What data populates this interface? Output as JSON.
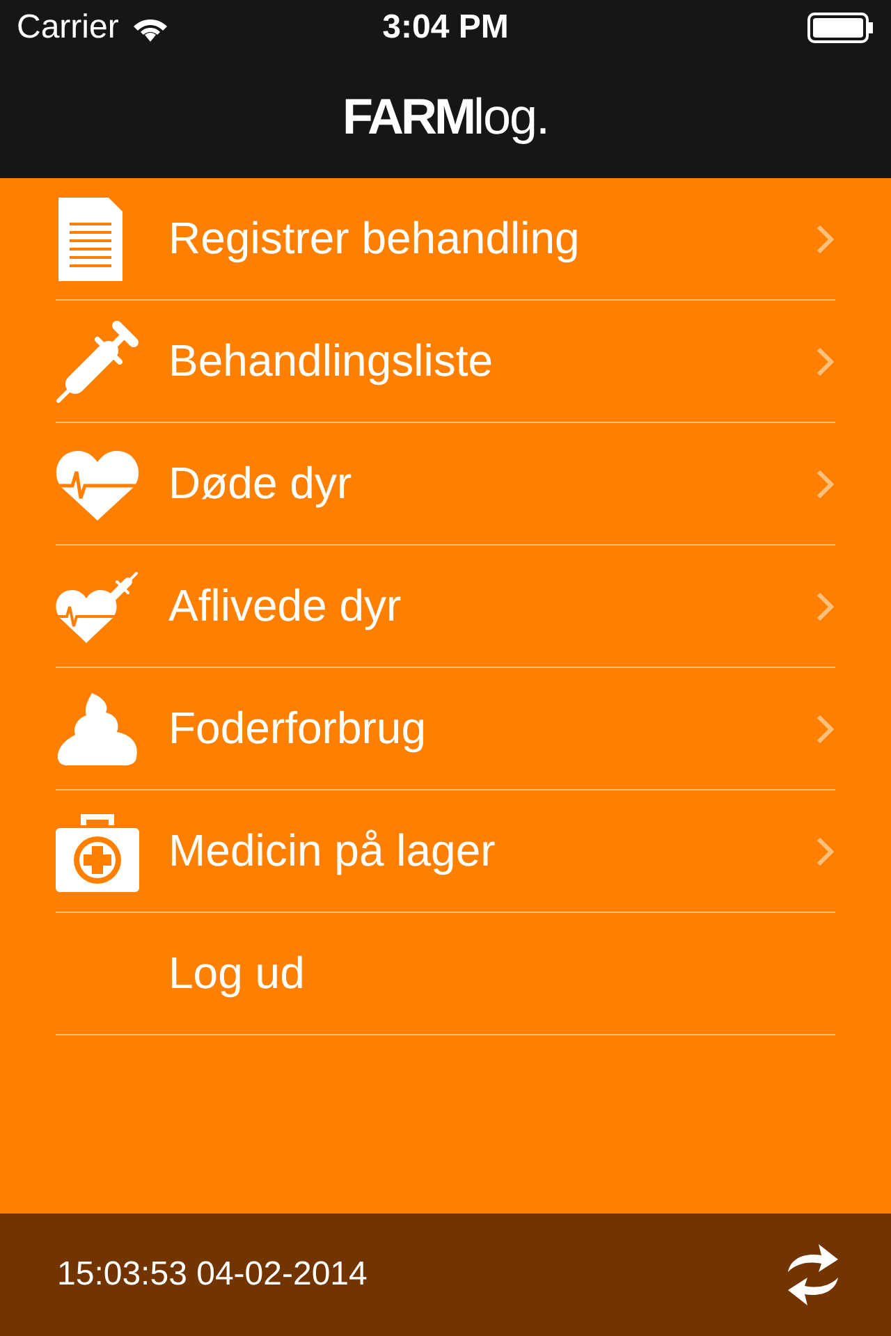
{
  "status_bar": {
    "carrier": "Carrier",
    "time": "3:04 PM"
  },
  "nav": {
    "logo_bold": "FARM",
    "logo_light": "log."
  },
  "menu": [
    {
      "label": "Registrer behandling",
      "kind": "document",
      "chevron": true
    },
    {
      "label": "Behandlingsliste",
      "kind": "syringe",
      "chevron": true
    },
    {
      "label": "Døde dyr",
      "kind": "heart",
      "chevron": true
    },
    {
      "label": "Aflivede dyr",
      "kind": "heartsyringe",
      "chevron": true
    },
    {
      "label": "Foderforbrug",
      "kind": "feed",
      "chevron": true
    },
    {
      "label": "Medicin på lager",
      "kind": "medkit",
      "chevron": true
    },
    {
      "label": "Log ud",
      "kind": "plain",
      "chevron": false
    }
  ],
  "footer": {
    "timestamp": "15:03:53 04-02-2014"
  }
}
